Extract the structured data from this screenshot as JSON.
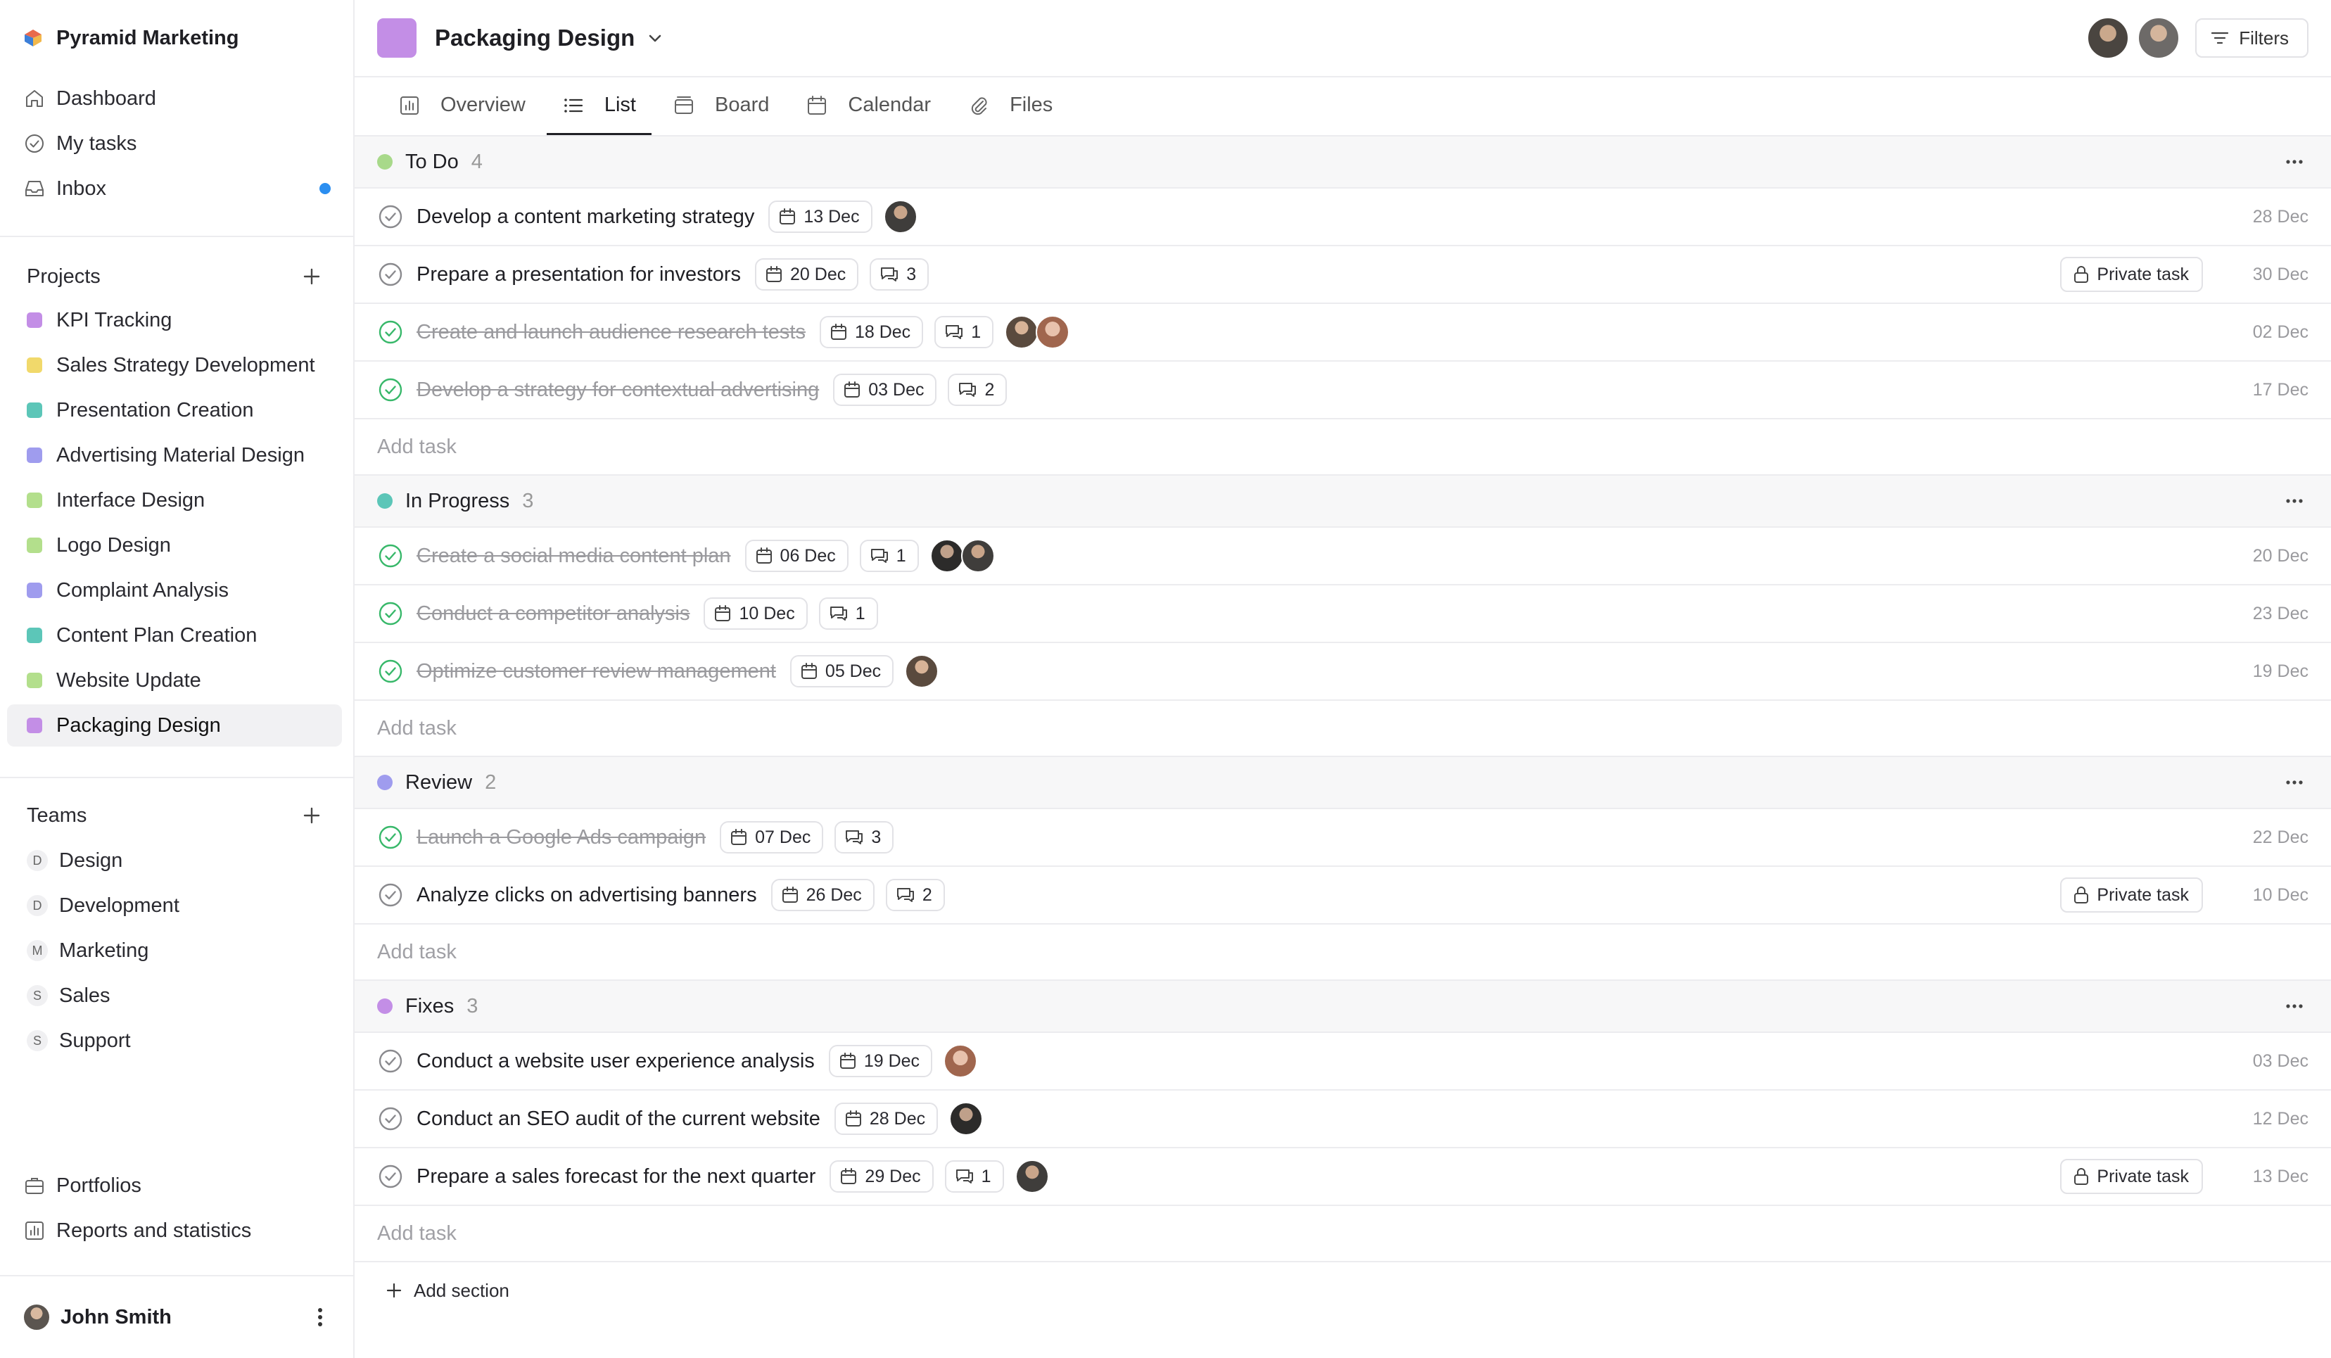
{
  "workspace": {
    "name": "Pyramid Marketing"
  },
  "nav": [
    {
      "label": "Dashboard",
      "icon": "home-icon"
    },
    {
      "label": "My tasks",
      "icon": "check-circle-icon"
    },
    {
      "label": "Inbox",
      "icon": "inbox-icon",
      "unread": true
    }
  ],
  "projects_section": {
    "title": "Projects"
  },
  "projects": [
    {
      "label": "KPI Tracking",
      "color": "#c38ee6"
    },
    {
      "label": "Sales Strategy Development",
      "color": "#f1d96b"
    },
    {
      "label": "Presentation Creation",
      "color": "#5cc6b8"
    },
    {
      "label": "Advertising Material Design",
      "color": "#9f9cee"
    },
    {
      "label": "Interface Design",
      "color": "#b3df8c"
    },
    {
      "label": "Logo Design",
      "color": "#b3df8c"
    },
    {
      "label": "Complaint Analysis",
      "color": "#9f9cee"
    },
    {
      "label": "Content Plan Creation",
      "color": "#5cc6b8"
    },
    {
      "label": "Website Update",
      "color": "#b3df8c"
    },
    {
      "label": "Packaging Design",
      "color": "#c38ee6",
      "active": true
    }
  ],
  "teams_section": {
    "title": "Teams"
  },
  "teams": [
    {
      "initial": "D",
      "label": "Design"
    },
    {
      "initial": "D",
      "label": "Development"
    },
    {
      "initial": "M",
      "label": "Marketing"
    },
    {
      "initial": "S",
      "label": "Sales"
    },
    {
      "initial": "S",
      "label": "Support"
    }
  ],
  "bottom_links": [
    {
      "label": "Portfolios",
      "icon": "briefcase-icon"
    },
    {
      "label": "Reports and statistics",
      "icon": "bar-chart-icon"
    }
  ],
  "user": {
    "name": "John Smith"
  },
  "header": {
    "title": "Packaging Design",
    "filters_label": "Filters"
  },
  "tabs": [
    {
      "label": "Overview",
      "icon": "bar-chart-icon"
    },
    {
      "label": "List",
      "icon": "list-icon",
      "active": true
    },
    {
      "label": "Board",
      "icon": "board-icon"
    },
    {
      "label": "Calendar",
      "icon": "calendar-icon"
    },
    {
      "label": "Files",
      "icon": "paperclip-icon"
    }
  ],
  "add_task_label": "Add task",
  "add_section_label": "Add section",
  "private_label": "Private task",
  "groups": [
    {
      "name": "To Do",
      "count": "4",
      "color": "#a8d98a",
      "tasks": [
        {
          "name": "Develop a content marketing strategy",
          "done": false,
          "date": "13 Dec",
          "comments": null,
          "avatars": 1,
          "private": false,
          "due": "28 Dec"
        },
        {
          "name": "Prepare a presentation for investors",
          "done": false,
          "date": "20 Dec",
          "comments": "3",
          "avatars": 0,
          "private": true,
          "due": "30 Dec"
        },
        {
          "name": "Create and launch audience research tests",
          "done": true,
          "date": "18 Dec",
          "comments": "1",
          "avatars": 2,
          "private": false,
          "due": "02 Dec"
        },
        {
          "name": "Develop a strategy for contextual advertising",
          "done": true,
          "date": "03 Dec",
          "comments": "2",
          "avatars": 0,
          "private": false,
          "due": "17 Dec"
        }
      ]
    },
    {
      "name": "In Progress",
      "count": "3",
      "color": "#5cc6b8",
      "tasks": [
        {
          "name": "Create a social media content plan",
          "done": true,
          "date": "06 Dec",
          "comments": "1",
          "avatars": 2,
          "private": false,
          "due": "20 Dec"
        },
        {
          "name": "Conduct a competitor analysis",
          "done": true,
          "date": "10 Dec",
          "comments": "1",
          "avatars": 0,
          "private": false,
          "due": "23 Dec"
        },
        {
          "name": "Optimize customer review management",
          "done": true,
          "date": "05 Dec",
          "comments": null,
          "avatars": 1,
          "private": false,
          "due": "19 Dec"
        }
      ]
    },
    {
      "name": "Review",
      "count": "2",
      "color": "#9f9cee",
      "tasks": [
        {
          "name": "Launch a Google Ads campaign",
          "done": true,
          "date": "07 Dec",
          "comments": "3",
          "avatars": 0,
          "private": false,
          "due": "22 Dec"
        },
        {
          "name": "Analyze clicks on advertising banners",
          "done": false,
          "date": "26 Dec",
          "comments": "2",
          "avatars": 0,
          "private": true,
          "due": "10 Dec"
        }
      ]
    },
    {
      "name": "Fixes",
      "count": "3",
      "color": "#c38ee6",
      "tasks": [
        {
          "name": "Conduct a website user experience analysis",
          "done": false,
          "date": "19 Dec",
          "comments": null,
          "avatars": 1,
          "private": false,
          "due": "03 Dec"
        },
        {
          "name": "Conduct an SEO audit of the current website",
          "done": false,
          "date": "28 Dec",
          "comments": null,
          "avatars": 1,
          "private": false,
          "due": "12 Dec"
        },
        {
          "name": "Prepare a sales forecast for the next quarter",
          "done": false,
          "date": "29 Dec",
          "comments": "1",
          "avatars": 1,
          "private": true,
          "due": "13 Dec"
        }
      ]
    }
  ]
}
